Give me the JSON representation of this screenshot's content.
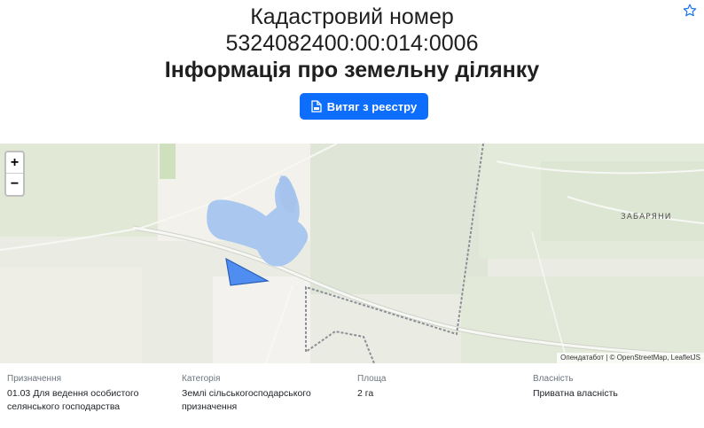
{
  "header": {
    "title_line1": "Кадастровий номер",
    "title_line2": "5324082400:00:014:0006",
    "title_line3": "Інформація про земельну ділянку",
    "extract_button_label": "Витяг з реєстру",
    "favorite_icon": "star-icon",
    "document_icon": "document-icon"
  },
  "map": {
    "zoom_in_label": "+",
    "zoom_out_label": "−",
    "place_label": "ЗАБАРЯНИ",
    "attribution_osm": "Опендатабот",
    "attribution_sep": " | © ",
    "attribution_osm2": "OpenStreetMap",
    "attribution_sep2": ", ",
    "attribution_leaflet": "LeafletJS",
    "parcel_color": "#4f8ef0",
    "water_color": "#aac8ef"
  },
  "info": {
    "purpose_label": "Призначення",
    "purpose_value_line1": "01.03 Для ведення особистого",
    "purpose_value_line2": "селянського господарства",
    "category_label": "Категорія",
    "category_value_line1": "Землі сільськогосподарського",
    "category_value_line2": "призначення",
    "area_label": "Площа",
    "area_value": "2 га",
    "ownership_label": "Власність",
    "ownership_value": "Приватна власність"
  },
  "colors": {
    "accent": "#0d6efd"
  }
}
